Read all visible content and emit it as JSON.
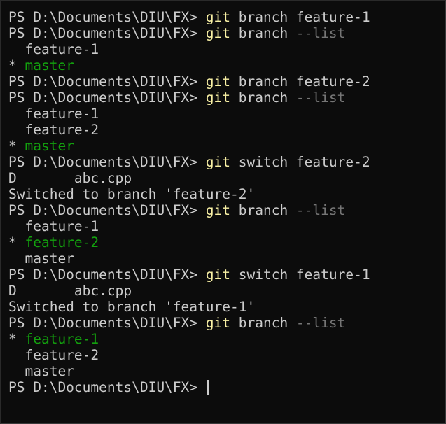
{
  "terminal": {
    "prompt": "PS D:\\Documents\\DIU\\FX> ",
    "lines": {
      "l1": {
        "cmd": "git",
        "rest": " branch feature-1"
      },
      "l2": {
        "cmd": "git",
        "rest": " branch ",
        "flag": "--list"
      },
      "l3": {
        "text": "  feature-1"
      },
      "l4": {
        "star": "* ",
        "current": "master"
      },
      "l5": {
        "cmd": "git",
        "rest": " branch feature-2"
      },
      "l6": {
        "cmd": "git",
        "rest": " branch ",
        "flag": "--list"
      },
      "l7": {
        "text": "  feature-1"
      },
      "l8": {
        "text": "  feature-2"
      },
      "l9": {
        "star": "* ",
        "current": "master"
      },
      "l10": {
        "cmd": "git",
        "rest": " switch feature-2"
      },
      "l11": {
        "text": "D       abc.cpp"
      },
      "l12": {
        "text": "Switched to branch 'feature-2'"
      },
      "l13": {
        "cmd": "git",
        "rest": " branch ",
        "flag": "--list"
      },
      "l14": {
        "text": "  feature-1"
      },
      "l15": {
        "star": "* ",
        "current": "feature-2"
      },
      "l16": {
        "text": "  master"
      },
      "l17": {
        "cmd": "git",
        "rest": " switch feature-1"
      },
      "l18": {
        "text": "D       abc.cpp"
      },
      "l19": {
        "text": "Switched to branch 'feature-1'"
      },
      "l20": {
        "cmd": "git",
        "rest": " branch ",
        "flag": "--list"
      },
      "l21": {
        "star": "* ",
        "current": "feature-1"
      },
      "l22": {
        "text": "  feature-2"
      },
      "l23": {
        "text": "  master"
      }
    }
  },
  "colors": {
    "background": "#0c0c0c",
    "text": "#cccccc",
    "command": "#f9f1a5",
    "flag": "#767676",
    "current_branch": "#13a10e"
  }
}
